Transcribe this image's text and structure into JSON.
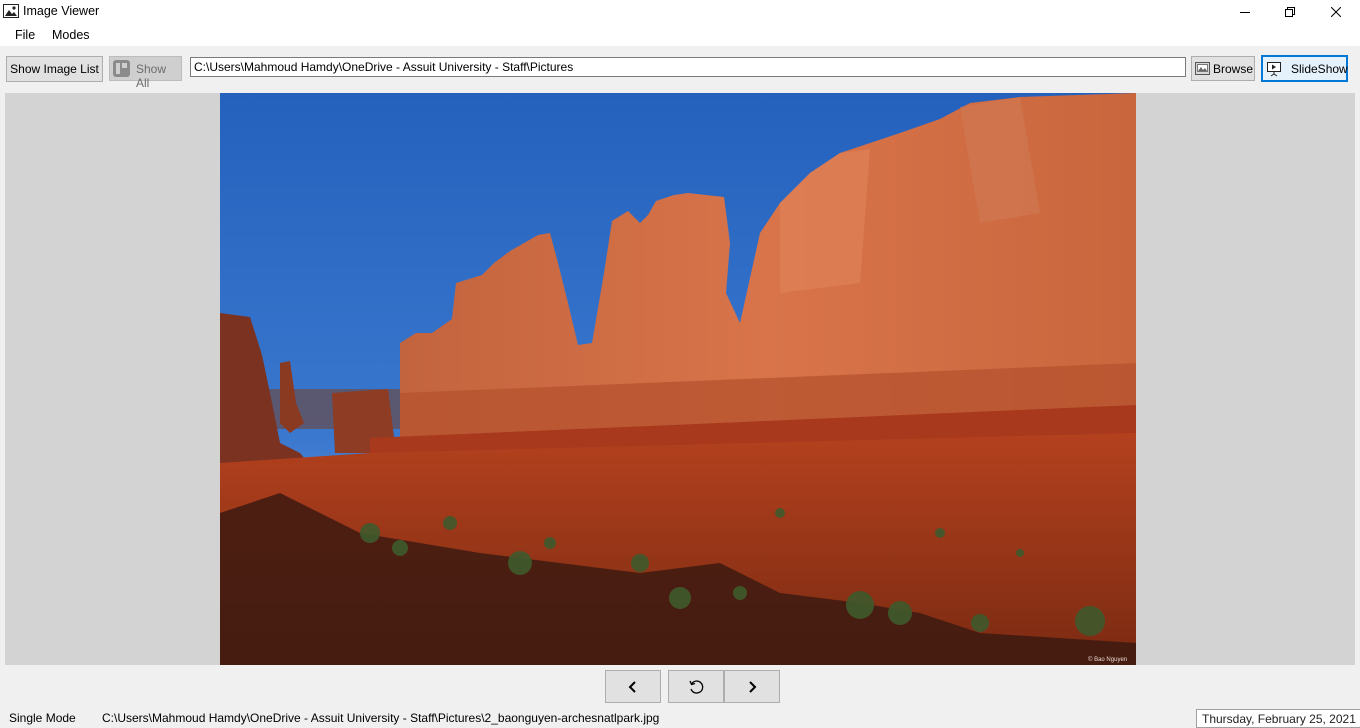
{
  "window": {
    "title": "Image Viewer",
    "controls": [
      "minimize-icon",
      "restore-icon",
      "close-icon"
    ]
  },
  "menu": {
    "items": [
      "File",
      "Modes"
    ]
  },
  "toolbar": {
    "show_image_list_label": "Show Image List",
    "show_all_label": "Show All",
    "path_value": "C:\\Users\\Mahmoud Hamdy\\OneDrive - Assuit University - Staff\\Pictures",
    "browse_label": "Browse",
    "slideshow_label": "SlideShow"
  },
  "viewer": {
    "image_semantic": "red-rock-canyon-photo",
    "watermark": "© Bao Nguyen"
  },
  "navigation": {
    "prev_icon": "chevron-left-icon",
    "rotate_icon": "rotate-icon",
    "next_icon": "chevron-right-icon"
  },
  "status": {
    "mode": "Single Mode",
    "file_path": "C:\\Users\\Mahmoud Hamdy\\OneDrive - Assuit University - Staff\\Pictures\\2_baonguyen-archesnatlpark.jpg",
    "date": "Thursday, February 25, 2021"
  },
  "colors": {
    "accent": "#0078d7",
    "sky": "#2a62b8",
    "rock": "#c0552f"
  }
}
